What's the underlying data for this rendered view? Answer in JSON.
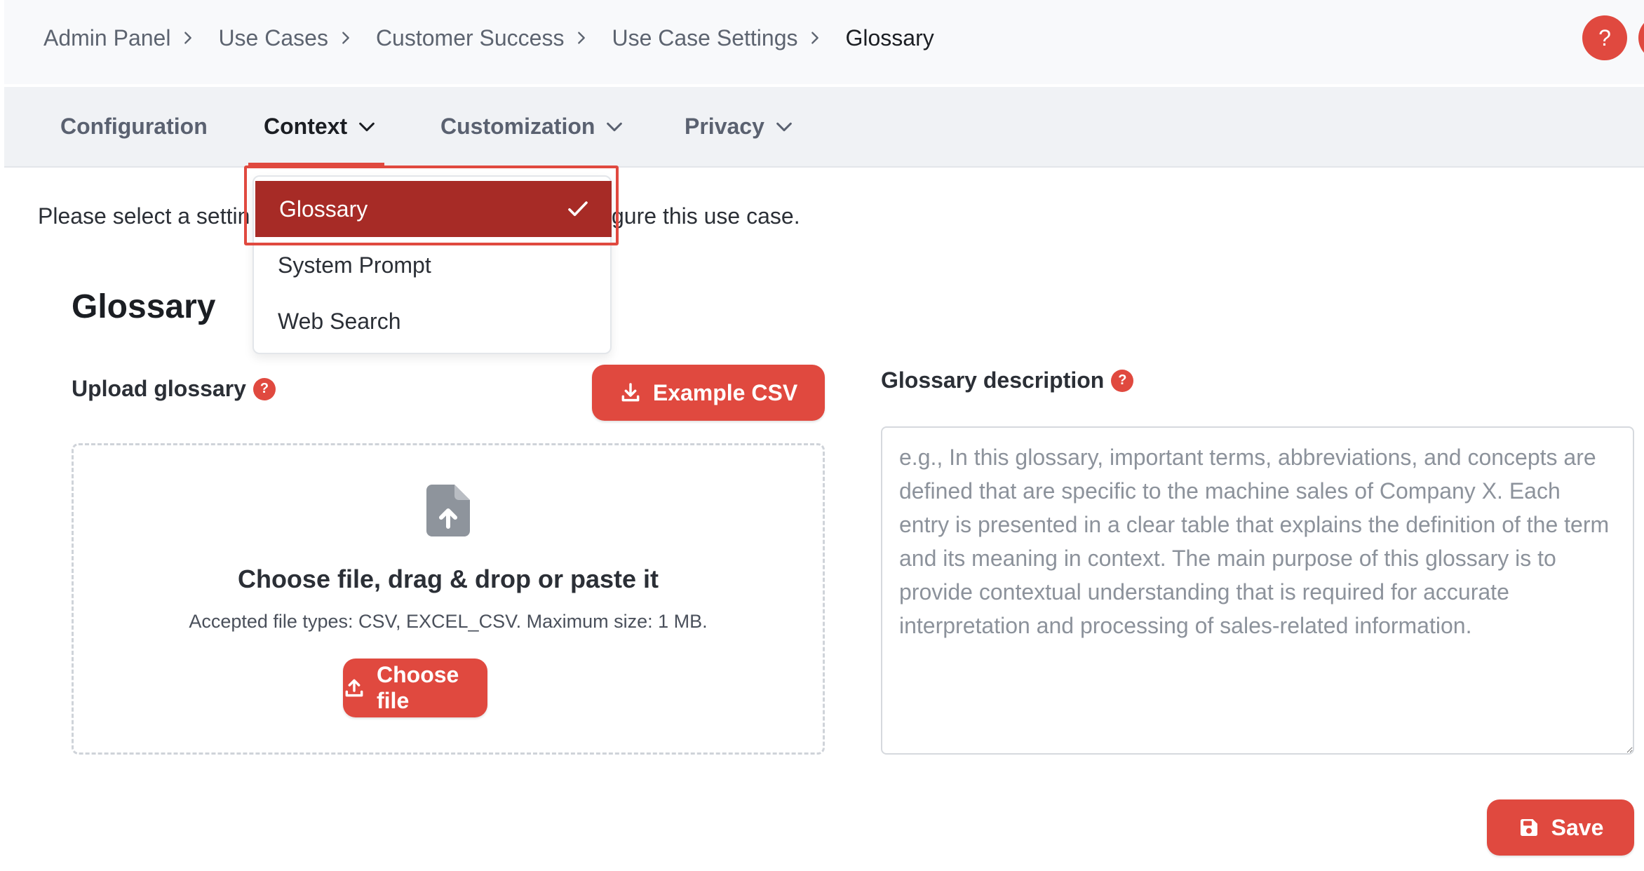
{
  "breadcrumb": {
    "items": [
      "Admin Panel",
      "Use Cases",
      "Customer Success",
      "Use Case Settings",
      "Glossary"
    ]
  },
  "header": {
    "help_label": "?"
  },
  "tabs": [
    {
      "label": "Configuration",
      "has_dropdown": false
    },
    {
      "label": "Context",
      "has_dropdown": true,
      "active": true
    },
    {
      "label": "Customization",
      "has_dropdown": true
    },
    {
      "label": "Privacy",
      "has_dropdown": true
    }
  ],
  "context_menu": {
    "items": [
      "Glossary",
      "System Prompt",
      "Web Search"
    ],
    "selected": "Glossary"
  },
  "intro": {
    "text_visible_left": "Please select a settin",
    "text_visible_right": "gure this use case."
  },
  "glossary": {
    "title": "Glossary",
    "upload_label": "Upload glossary",
    "upload_help": "?",
    "example_csv_label": "Example CSV",
    "dropzone_title": "Choose file, drag & drop or paste it",
    "dropzone_subtitle": "Accepted file types: CSV, EXCEL_CSV. Maximum size: 1 MB.",
    "choose_file_label": "Choose file",
    "description_label": "Glossary description",
    "description_help": "?",
    "description_value": "",
    "description_placeholder": "e.g., In this glossary, important terms, abbreviations, and concepts are defined that are specific to the machine sales of Company X. Each entry is presented in a clear table that explains the definition of the term and its meaning in context. The main purpose of this glossary is to provide contextual understanding that is required for accurate interpretation and processing of sales-related information.",
    "save_label": "Save"
  },
  "colors": {
    "accent": "#e0493f",
    "selected_item": "#a72b26",
    "tab_bar": "#f0f2f5"
  },
  "icons": {
    "breadcrumb_separator": "chevron-right-icon",
    "tab_dropdown": "chevron-down-icon",
    "selected": "check-icon",
    "download": "download-icon",
    "upload": "upload-icon",
    "file": "file-upload-icon",
    "save": "floppy-disk-icon"
  }
}
